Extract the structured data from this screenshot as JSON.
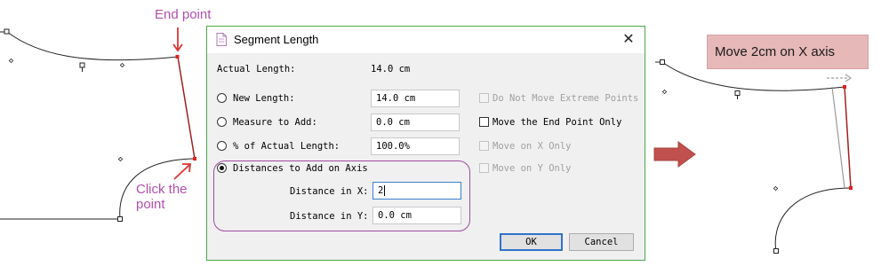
{
  "callouts": {
    "end_point": "End point",
    "click_point_line1": "Click the",
    "click_point_line2": "point",
    "move_note": "Move 2cm on X axis"
  },
  "dialog": {
    "title": "Segment Length",
    "actual_length_label": "Actual Length:",
    "actual_length_value": "14.0 cm",
    "options": [
      {
        "label": "New Length:",
        "value": "14.0 cm",
        "selected": false
      },
      {
        "label": "Measure to Add:",
        "value": "0.0 cm",
        "selected": false
      },
      {
        "label": "% of Actual Length:",
        "value": "100.0%",
        "selected": false
      },
      {
        "label": "Distances to Add on Axis",
        "selected": true
      }
    ],
    "distance_x_label": "Distance in X:",
    "distance_x_value": "2",
    "distance_y_label": "Distance in Y:",
    "distance_y_value": "0.0 cm",
    "checkboxes": [
      {
        "label": "Do Not Move Extreme Points",
        "checked": false,
        "enabled": false
      },
      {
        "label": "Move the End Point Only",
        "checked": false,
        "enabled": true
      },
      {
        "label": "Move on X Only",
        "checked": false,
        "enabled": false
      },
      {
        "label": "Move on Y Only",
        "checked": false,
        "enabled": false
      }
    ],
    "ok_label": "OK",
    "cancel_label": "Cancel"
  },
  "colors": {
    "callout_purple": "#b14fb0",
    "arrow_red": "#e03030",
    "segment_red": "#a02020",
    "dialog_border": "#4aa84a",
    "note_fill": "#e6b8b8",
    "big_arrow": "#c0504d"
  },
  "icons": [
    "close-icon",
    "document-icon",
    "arrow-right-icon"
  ]
}
